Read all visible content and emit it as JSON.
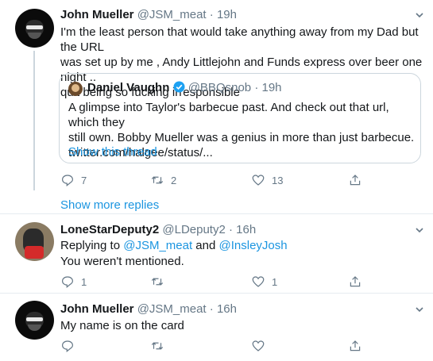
{
  "tweet1": {
    "name": "John Mueller",
    "handle": "@JSM_meat",
    "time": "19h",
    "text_line1": "I'm the least person that would take anything away from my Dad but the URL",
    "text_line2": "was set up by me , Andy Littlejohn and Funds  express over beer one night ..",
    "text_line3": "quit being so fucking irresponsible",
    "quote": {
      "name": "Daniel Vaughn",
      "handle": "@BBQsnob",
      "time": "19h",
      "line1": "A glimpse into Taylor's barbecue past. And check out that url, which they",
      "line2": "still own. Bobby Mueller was a genius in more than just barbecue.",
      "line3": "twitter.com/halgee/status/...",
      "show_thread": "Show this thread"
    },
    "replies": "7",
    "retweets": "2",
    "likes": "13"
  },
  "show_more": "Show more replies",
  "tweet2": {
    "name": "LoneStarDeputy2",
    "handle": "@LDeputy2",
    "time": "16h",
    "replying_prefix": "Replying to ",
    "replying_user1": "@JSM_meat",
    "replying_and": " and ",
    "replying_user2": "@InsleyJosh",
    "text": "You weren't mentioned.",
    "replies": "1",
    "retweets": "",
    "likes": "1"
  },
  "tweet3": {
    "name": "John Mueller",
    "handle": "@JSM_meat",
    "time": "16h",
    "text": "My name is on the card",
    "replies": "",
    "retweets": "",
    "likes": ""
  },
  "icons": {
    "reply": "reply-icon",
    "retweet": "retweet-icon",
    "like": "heart-icon",
    "share": "share-icon",
    "chevron": "chevron-down-icon",
    "verified": "verified-badge-icon"
  },
  "colors": {
    "link": "#1b95e0",
    "muted": "#657786",
    "text": "#14171a",
    "border": "#ccd6dd"
  }
}
